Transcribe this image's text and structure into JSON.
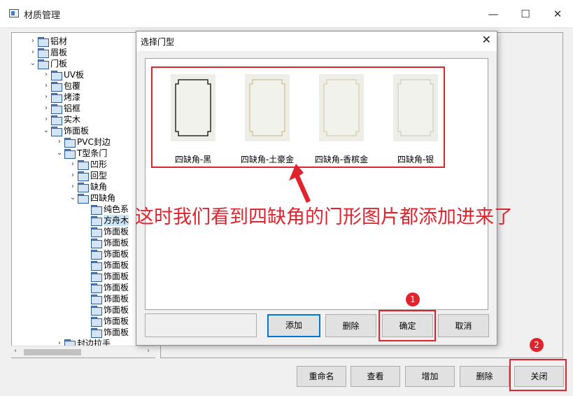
{
  "window": {
    "title": "材质管理",
    "minimize": "—",
    "maximize": "☐",
    "close": "✕"
  },
  "tree": {
    "rows": [
      {
        "label": "铝材",
        "arrow": "›",
        "indent": 0
      },
      {
        "label": "眉板",
        "arrow": "›",
        "indent": 0
      },
      {
        "label": "门板",
        "arrow": "⌄",
        "indent": 0
      },
      {
        "label": "UV板",
        "arrow": "›",
        "indent": 1
      },
      {
        "label": "包覆",
        "arrow": "›",
        "indent": 1
      },
      {
        "label": "烤漆",
        "arrow": "›",
        "indent": 1
      },
      {
        "label": "铝框",
        "arrow": "›",
        "indent": 1
      },
      {
        "label": "实木",
        "arrow": "›",
        "indent": 1
      },
      {
        "label": "饰面板",
        "arrow": "⌄",
        "indent": 1
      },
      {
        "label": "PVC封边",
        "arrow": "›",
        "indent": 2
      },
      {
        "label": "T型条门",
        "arrow": "⌄",
        "indent": 2
      },
      {
        "label": "凹形",
        "arrow": "›",
        "indent": 3
      },
      {
        "label": "回型",
        "arrow": "›",
        "indent": 3
      },
      {
        "label": "缺角",
        "arrow": "›",
        "indent": 3
      },
      {
        "label": "四缺角",
        "arrow": "⌄",
        "indent": 3
      },
      {
        "label": "纯色系",
        "arrow": "",
        "indent": 4
      },
      {
        "label": "方舟木",
        "arrow": "",
        "indent": 4,
        "selected": true
      },
      {
        "label": "饰面板",
        "arrow": "",
        "indent": 4
      },
      {
        "label": "饰面板",
        "arrow": "",
        "indent": 4
      },
      {
        "label": "饰面板",
        "arrow": "",
        "indent": 4
      },
      {
        "label": "饰面板",
        "arrow": "",
        "indent": 4
      },
      {
        "label": "饰面板",
        "arrow": "",
        "indent": 4
      },
      {
        "label": "饰面板",
        "arrow": "",
        "indent": 4
      },
      {
        "label": "饰面板",
        "arrow": "",
        "indent": 4
      },
      {
        "label": "饰面板",
        "arrow": "",
        "indent": 4
      },
      {
        "label": "饰面板",
        "arrow": "",
        "indent": 4
      },
      {
        "label": "饰面板",
        "arrow": "",
        "indent": 4
      },
      {
        "label": "封边拉手",
        "arrow": "›",
        "indent": 2
      }
    ]
  },
  "footer": {
    "rename": "重命名",
    "view": "查看",
    "add": "增加",
    "delete": "删除",
    "close": "关闭"
  },
  "dialog": {
    "title": "选择门型",
    "close": "✕",
    "thumbnails": [
      {
        "label": "四缺角-黑",
        "stroke": "#2b2b2b"
      },
      {
        "label": "四缺角-土豪金",
        "stroke": "#c9b27a"
      },
      {
        "label": "四缺角-香槟金",
        "stroke": "#d8c29c"
      },
      {
        "label": "四缺角-银",
        "stroke": "#c4c4c4"
      }
    ],
    "buttons": {
      "add": "添加",
      "delete": "删除",
      "confirm": "确定",
      "cancel": "取消"
    }
  },
  "annotation": {
    "text": "这时我们看到四缺角的门形图片都添加进来了",
    "badge1": "1",
    "badge2": "2",
    "color": "#e0242e"
  }
}
